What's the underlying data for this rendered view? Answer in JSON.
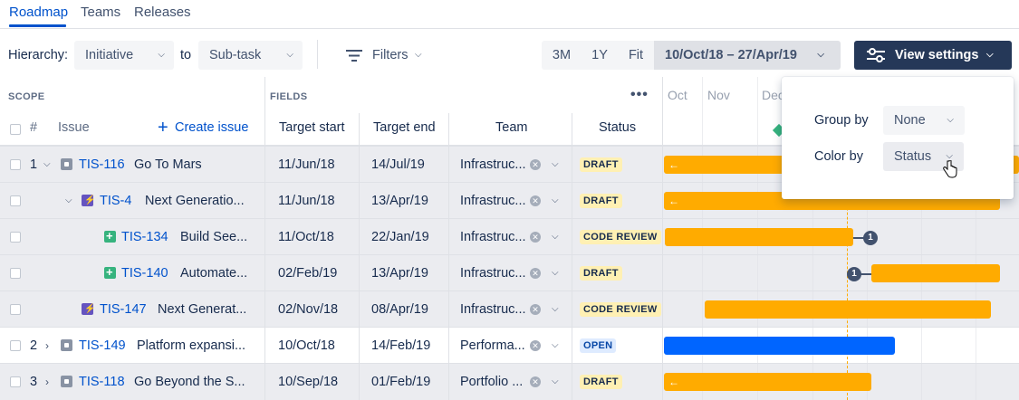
{
  "tabs": [
    {
      "label": "Roadmap",
      "active": true
    },
    {
      "label": "Teams",
      "active": false
    },
    {
      "label": "Releases",
      "active": false
    }
  ],
  "toolbar": {
    "hierarchy_label": "Hierarchy:",
    "hierarchy_from": "Initiative",
    "to_label": "to",
    "hierarchy_to": "Sub-task",
    "filters_label": "Filters",
    "zoom_options": [
      "3M",
      "1Y",
      "Fit"
    ],
    "date_range": "10/Oct/18 – 27/Apr/19",
    "view_settings_label": "View settings"
  },
  "headers": {
    "scope": "SCOPE",
    "fields": "FIELDS",
    "hash": "#",
    "issue": "Issue",
    "create_issue": "Create issue",
    "target_start": "Target start",
    "target_end": "Target end",
    "team": "Team",
    "status": "Status",
    "months": [
      "Oct",
      "Nov",
      "Dec"
    ]
  },
  "rows": [
    {
      "num": "1",
      "expander": "down",
      "type": "initiative",
      "key": "TIS-116",
      "summary": "Go To Mars",
      "start": "11/Jun/18",
      "end": "14/Jul/19",
      "team": "Infrastruc...",
      "status": "DRAFT"
    },
    {
      "num": "",
      "expander": "down",
      "type": "epic",
      "key": "TIS-4",
      "summary": "Next Generatio...",
      "start": "11/Jun/18",
      "end": "13/Apr/19",
      "team": "Infrastruc...",
      "status": "DRAFT"
    },
    {
      "num": "",
      "expander": "",
      "type": "story",
      "key": "TIS-134",
      "summary": "Build See...",
      "start": "11/Oct/18",
      "end": "22/Jan/19",
      "team": "Infrastruc...",
      "status": "CODE REVIEW"
    },
    {
      "num": "",
      "expander": "",
      "type": "story",
      "key": "TIS-140",
      "summary": "Automate...",
      "start": "02/Feb/19",
      "end": "13/Apr/19",
      "team": "Infrastruc...",
      "status": "DRAFT"
    },
    {
      "num": "",
      "expander": "",
      "type": "epic",
      "key": "TIS-147",
      "summary": "Next Generat...",
      "start": "02/Nov/18",
      "end": "08/Apr/19",
      "team": "Infrastruc...",
      "status": "CODE REVIEW"
    },
    {
      "num": "2",
      "expander": "right",
      "type": "initiative",
      "key": "TIS-149",
      "summary": "Platform expansi...",
      "start": "10/Oct/18",
      "end": "14/Feb/19",
      "team": "Performa...",
      "status": "OPEN"
    },
    {
      "num": "3",
      "expander": "right",
      "type": "initiative",
      "key": "TIS-118",
      "summary": "Go Beyond the S...",
      "start": "10/Sep/18",
      "end": "01/Feb/19",
      "team": "Portfolio ...",
      "status": "DRAFT"
    }
  ],
  "dependencies": [
    "1",
    "1"
  ],
  "popup": {
    "group_by_label": "Group by",
    "group_by_value": "None",
    "color_by_label": "Color by",
    "color_by_value": "Status"
  },
  "colors": {
    "accent": "#0052cc",
    "bar_draft": "#ffab00",
    "bar_open": "#0065ff",
    "view_settings_bg": "#253858"
  }
}
